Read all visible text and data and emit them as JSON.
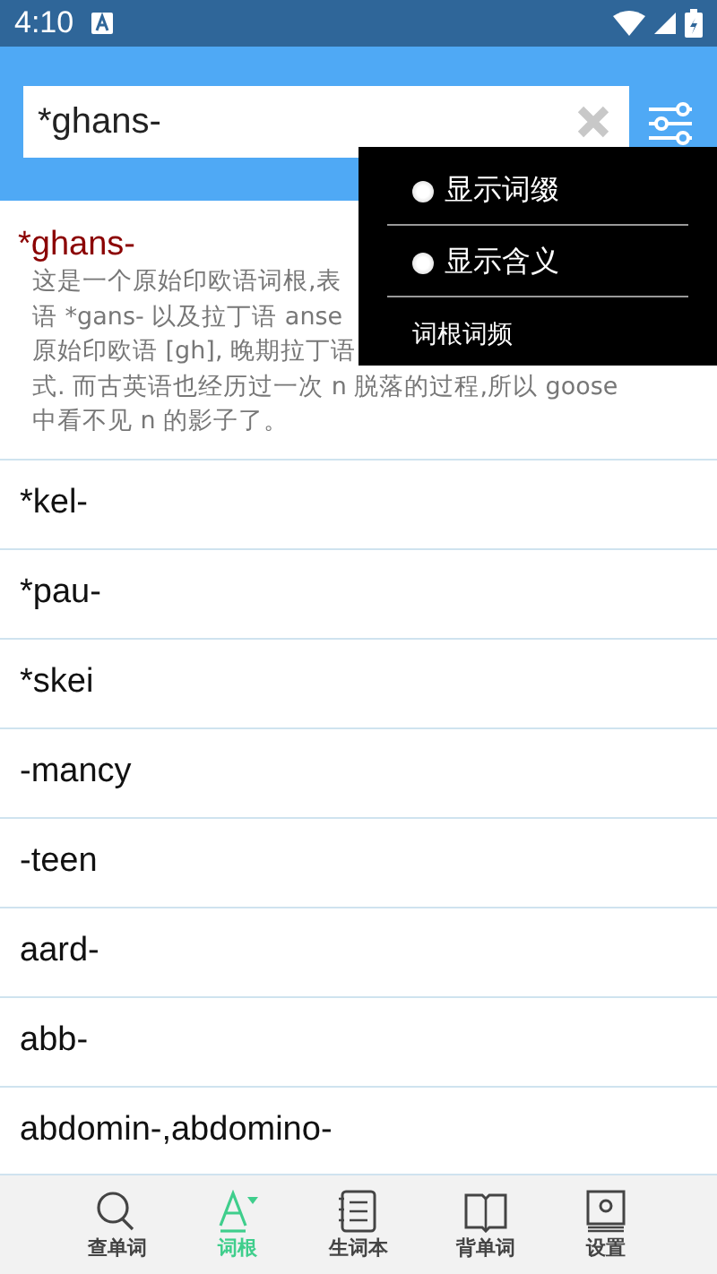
{
  "status_bar": {
    "time": "4:10"
  },
  "search": {
    "value": "*ghans-"
  },
  "menu": {
    "items": [
      {
        "kind": "radio",
        "label": "显示词缀",
        "checked": false
      },
      {
        "kind": "radio",
        "label": "显示含义",
        "checked": false
      },
      {
        "kind": "plain",
        "label": "词根词频"
      }
    ]
  },
  "detail": {
    "title": "*ghans-",
    "lines": [
      "这是一个原始印欧语词根,表",
      "语 *gans- 以及拉丁语 anse",
      "原始印欧语 [gh], 晚期拉丁语",
      "式. 而古英语也经历过一次 n 脱落的过程,所以 goose",
      "中看不见 n 的影子了。"
    ]
  },
  "list": [
    "*kel-",
    "*pau-",
    "*skei",
    "-mancy",
    "-teen",
    "aard-",
    "abb-",
    "abdomin-,abdomino-"
  ],
  "tabs": [
    {
      "label": "查单词",
      "selected": false
    },
    {
      "label": "词根",
      "selected": true
    },
    {
      "label": "生词本",
      "selected": false
    },
    {
      "label": "背单词",
      "selected": false
    },
    {
      "label": "设置",
      "selected": false
    }
  ]
}
